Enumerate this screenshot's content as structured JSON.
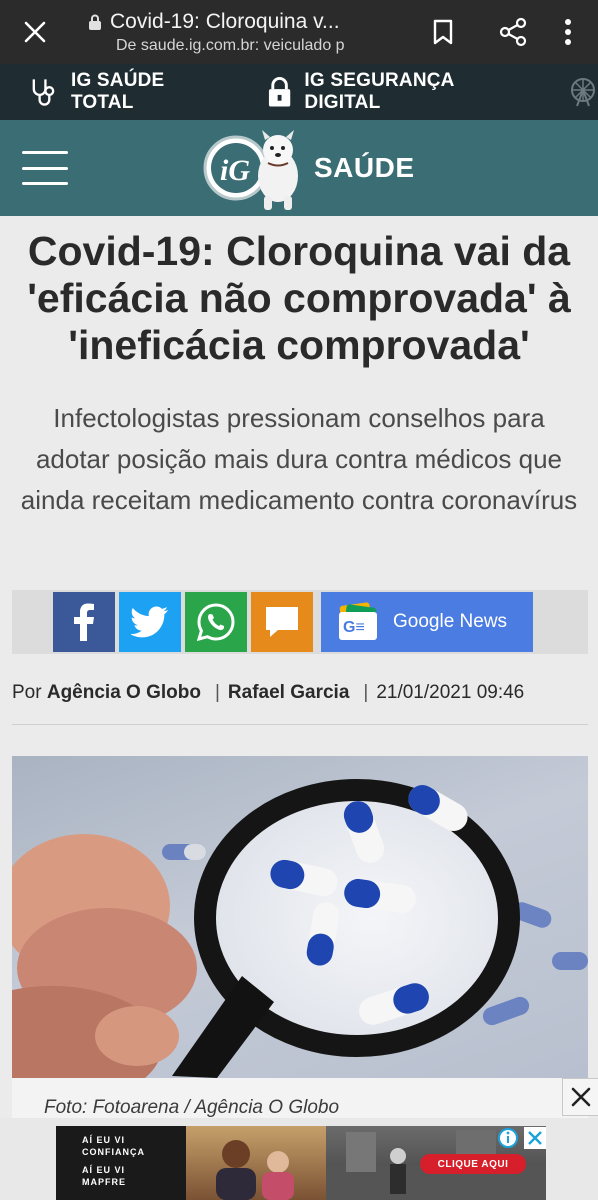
{
  "browser": {
    "title": "Covid-19: Cloroquina v...",
    "url": "De saude.ig.com.br: veiculado p"
  },
  "topnav": {
    "items": [
      {
        "label": "IG SAÚDE TOTAL",
        "icon": "stethoscope-icon"
      },
      {
        "label": "IG SEGURANÇA DIGITAL",
        "icon": "padlock-icon"
      }
    ]
  },
  "header": {
    "logo_text": "iG",
    "section": "SAÚDE"
  },
  "article": {
    "headline": "Covid-19: Cloroquina vai da 'eficácia não comprovada' à 'ineficácia comprovada'",
    "subheadline": "Infectologistas pressionam conselhos para adotar posição mais dura contra médicos que ainda receitam medicamento contra coronavírus",
    "byline_prefix": "Por",
    "source": "Agência O Globo",
    "author": "Rafael Garcia",
    "date": "21/01/2021 09:46",
    "caption": "Foto: Fotoarena / Agência O Globo"
  },
  "share": {
    "google_news_label": "Google News",
    "google_news_badge": "G≡"
  },
  "ad": {
    "line1": "AÍ EU VI",
    "line2": "CONFIANÇA",
    "line3": "AÍ EU VI",
    "line4": "MAPFRE",
    "cta": "CLIQUE AQUI"
  },
  "colors": {
    "browser_bar": "#2b2b2b",
    "topnav": "#1f2d33",
    "header": "#3a6e74",
    "facebook": "#3b5998",
    "twitter": "#1da1f2",
    "whatsapp": "#2aa549",
    "comment": "#e58a1b",
    "google_news": "#4a7ce2"
  }
}
